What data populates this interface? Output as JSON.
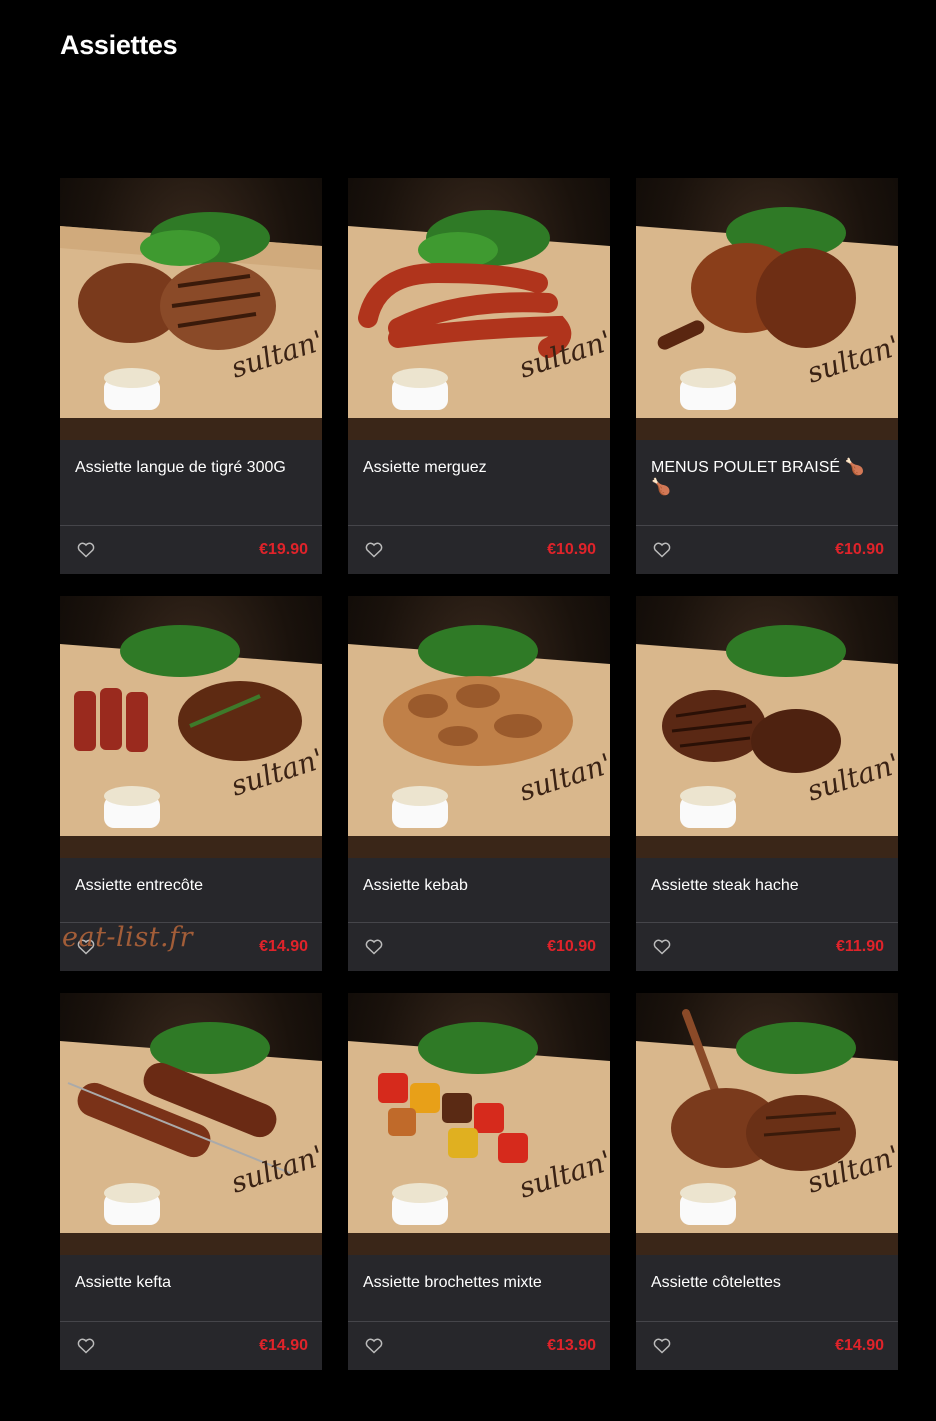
{
  "page": {
    "title": "Assiettes"
  },
  "watermark": "eat-list.fr",
  "colors": {
    "background": "#000000",
    "card": "#27272b",
    "price": "#e0232a"
  },
  "products": [
    {
      "name": "Assiette langue de tigré 300G",
      "price": "€19.90",
      "image": "grilled-steak-plate"
    },
    {
      "name": "Assiette merguez",
      "price": "€10.90",
      "image": "merguez-sausages-plate"
    },
    {
      "name": "MENUS POULET BRAISÉ 🍗🍗",
      "price": "€10.90",
      "image": "roasted-chicken-plate"
    },
    {
      "name": "Assiette entrecôte",
      "price": "€14.90",
      "image": "sliced-entrecote-plate"
    },
    {
      "name": "Assiette kebab",
      "price": "€10.90",
      "image": "kebab-meat-plate"
    },
    {
      "name": "Assiette steak hache",
      "price": "€11.90",
      "image": "burger-patties-plate"
    },
    {
      "name": "Assiette kefta",
      "price": "€14.90",
      "image": "kefta-skewers-plate"
    },
    {
      "name": "Assiette brochettes mixte",
      "price": "€13.90",
      "image": "mixed-skewers-plate"
    },
    {
      "name": "Assiette côtelettes",
      "price": "€14.90",
      "image": "lamb-chops-plate"
    }
  ]
}
